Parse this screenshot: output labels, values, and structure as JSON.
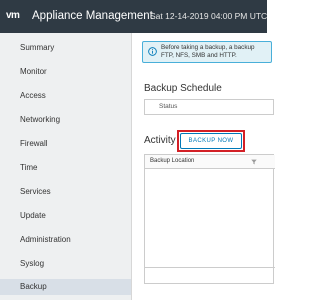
{
  "header": {
    "logo": "vm",
    "title": "Appliance Management",
    "datetime": "Sat 12-14-2019 04:00 PM UTC",
    "background": "#2f3a44"
  },
  "sidebar": {
    "items": [
      {
        "label": "Summary"
      },
      {
        "label": "Monitor"
      },
      {
        "label": "Access"
      },
      {
        "label": "Networking"
      },
      {
        "label": "Firewall"
      },
      {
        "label": "Time"
      },
      {
        "label": "Services"
      },
      {
        "label": "Update"
      },
      {
        "label": "Administration"
      },
      {
        "label": "Syslog"
      },
      {
        "label": "Backup",
        "active": true
      }
    ]
  },
  "main": {
    "banner": {
      "icon": "info-circle-icon",
      "line1": "Before taking a backup, a backup",
      "line2": "FTP, NFS, SMB and HTTP."
    },
    "schedule": {
      "title": "Backup Schedule",
      "status_label": "Status"
    },
    "activity": {
      "title": "Activity",
      "backup_now_label": "BACKUP NOW",
      "highlight_color": "#d32026",
      "columns": [
        "Backup Location"
      ]
    }
  }
}
